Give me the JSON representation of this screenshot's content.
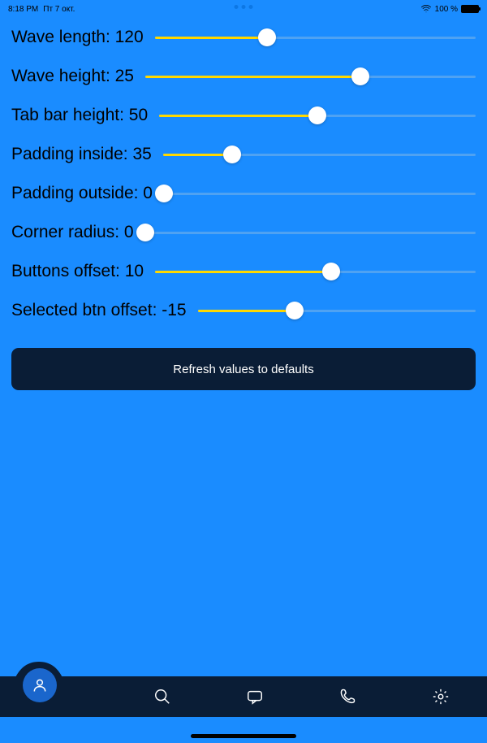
{
  "statusbar": {
    "time": "8:18 PM",
    "date": "Пт 7 окт.",
    "battery_pct": "100 %"
  },
  "sliders": [
    {
      "label_prefix": "Wave length",
      "value": 120,
      "fill_pct": 35
    },
    {
      "label_prefix": "Wave height",
      "value": 25,
      "fill_pct": 65
    },
    {
      "label_prefix": "Tab bar height",
      "value": 50,
      "fill_pct": 50
    },
    {
      "label_prefix": "Padding inside",
      "value": 35,
      "fill_pct": 22
    },
    {
      "label_prefix": "Padding outside",
      "value": 0,
      "fill_pct": 0
    },
    {
      "label_prefix": "Corner radius",
      "value": 0,
      "fill_pct": 0
    },
    {
      "label_prefix": "Buttons offset",
      "value": 10,
      "fill_pct": 55
    },
    {
      "label_prefix": "Selected btn offset",
      "value": -15,
      "fill_pct": 35
    }
  ],
  "refresh_label": "Refresh values to defaults",
  "tabbar": {
    "items": [
      "person",
      "search",
      "chat",
      "phone",
      "settings"
    ],
    "selected": 0
  },
  "colors": {
    "bg": "#1a8cff",
    "dark": "#0a1d36",
    "accent": "#ffd800"
  }
}
